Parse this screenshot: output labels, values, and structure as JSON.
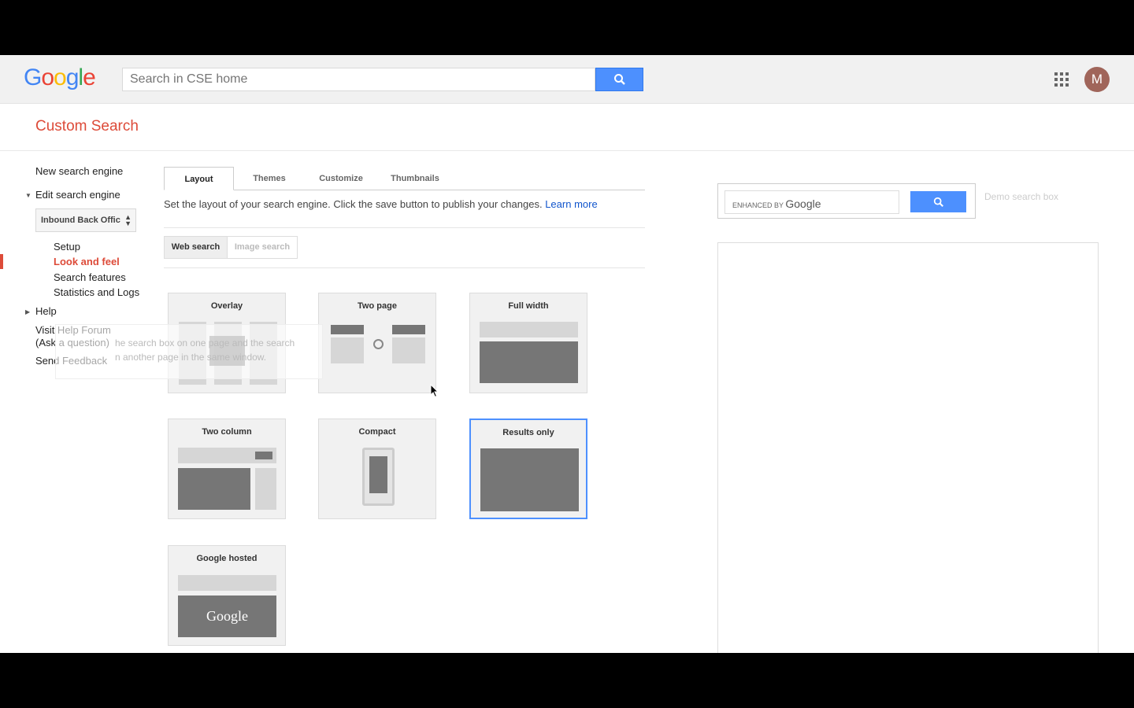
{
  "header": {
    "logo_text": "Google",
    "search_placeholder": "Search in CSE home",
    "avatar_letter": "M"
  },
  "product_title": "Custom Search",
  "sidebar": {
    "new_engine": "New search engine",
    "edit_engine": "Edit search engine",
    "engine_selected": "Inbound Back Offic",
    "items": [
      {
        "label": "Setup"
      },
      {
        "label": "Look and feel",
        "active": true
      },
      {
        "label": "Search features"
      },
      {
        "label": "Statistics and Logs"
      }
    ],
    "help": "Help",
    "visit_forum": "Visit Help Forum",
    "ask_question": "(Ask a question)",
    "send_feedback": "Send Feedback"
  },
  "tooltip": {
    "line1": "he search box on one page and the search",
    "line2": "n another page in the same window."
  },
  "tabs": [
    {
      "label": "Layout",
      "selected": true
    },
    {
      "label": "Themes"
    },
    {
      "label": "Customize"
    },
    {
      "label": "Thumbnails"
    }
  ],
  "description": {
    "text": "Set the layout of your search engine. Click the save button to publish your changes.",
    "link": "Learn more"
  },
  "search_type": {
    "web": "Web search",
    "image": "Image search"
  },
  "layouts": [
    {
      "label": "Overlay"
    },
    {
      "label": "Two page"
    },
    {
      "label": "Full width"
    },
    {
      "label": "Two column"
    },
    {
      "label": "Compact"
    },
    {
      "label": "Results only",
      "selected": true
    },
    {
      "label": "Google hosted",
      "logo": "Google"
    }
  ],
  "demo": {
    "enhanced_by": "ENHANCED BY",
    "brand": "Google",
    "label": "Demo search box"
  },
  "colors": {
    "accent_red": "#dd4b39",
    "button_blue": "#4d90fe",
    "link_blue": "#1155cc"
  }
}
